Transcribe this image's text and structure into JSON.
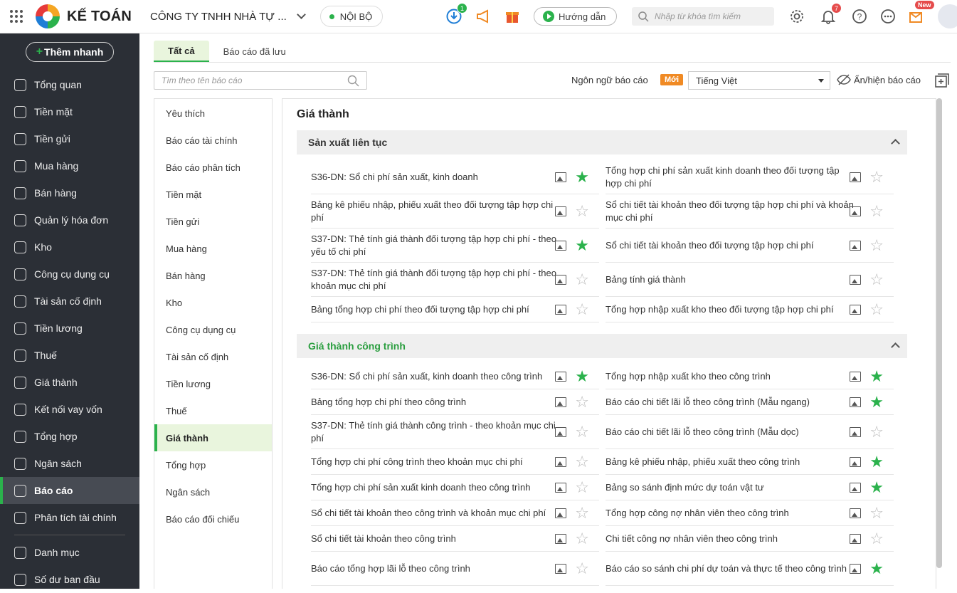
{
  "header": {
    "brand": "KẾ TOÁN",
    "company": "CÔNG TY TNHH NHÀ TỰ ...",
    "scope": "NỘI BỘ",
    "download_badge": "1",
    "guide_label": "Hướng dẫn",
    "search_placeholder": "Nhập từ khóa tìm kiếm",
    "notification_badge": "7",
    "new_badge": "New"
  },
  "sidebar": {
    "quick_add": "Thêm nhanh",
    "items": [
      {
        "label": "Tổng quan",
        "icon": "gauge-icon"
      },
      {
        "label": "Tiền mặt",
        "icon": "money-bag-icon"
      },
      {
        "label": "Tiền gửi",
        "icon": "bank-icon"
      },
      {
        "label": "Mua hàng",
        "icon": "shopping-bag-icon"
      },
      {
        "label": "Bán hàng",
        "icon": "cart-icon"
      },
      {
        "label": "Quản lý hóa đơn",
        "icon": "invoice-icon"
      },
      {
        "label": "Kho",
        "icon": "warehouse-icon"
      },
      {
        "label": "Công cụ dụng cụ",
        "icon": "tools-icon"
      },
      {
        "label": "Tài sản cố định",
        "icon": "car-icon"
      },
      {
        "label": "Tiền lương",
        "icon": "payroll-icon"
      },
      {
        "label": "Thuế",
        "icon": "tax-icon"
      },
      {
        "label": "Giá thành",
        "icon": "price-tag-icon"
      },
      {
        "label": "Kết nối vay vốn",
        "icon": "loan-icon"
      },
      {
        "label": "Tổng hợp",
        "icon": "summary-icon"
      },
      {
        "label": "Ngân sách",
        "icon": "budget-icon"
      },
      {
        "label": "Báo cáo",
        "icon": "report-icon",
        "active": true
      },
      {
        "label": "Phân tích tài chính",
        "icon": "analysis-icon"
      },
      {
        "label": "Danh mục",
        "icon": "list-icon"
      },
      {
        "label": "Số dư ban đầu",
        "icon": "balance-icon"
      }
    ]
  },
  "tabs": [
    "Tất cả",
    "Báo cáo đã lưu"
  ],
  "toolbar": {
    "search_placeholder": "Tìm theo tên báo cáo",
    "lang_label": "Ngôn ngữ báo cáo",
    "new_tag": "Mới",
    "lang_value": "Tiếng Việt",
    "toggle_label": "Ẩn/hiện báo cáo"
  },
  "categories": [
    "Yêu thích",
    "Báo cáo tài chính",
    "Báo cáo phân tích",
    "Tiền mặt",
    "Tiền gửi",
    "Mua hàng",
    "Bán hàng",
    "Kho",
    "Công cụ dụng cụ",
    "Tài sản cố định",
    "Tiền lương",
    "Thuế",
    "Giá thành",
    "Tổng hợp",
    "Ngân sách",
    "Báo cáo đối chiếu"
  ],
  "active_category": "Giá thành",
  "main": {
    "title": "Giá thành",
    "sections": [
      {
        "title": "Sản xuất liên tục",
        "highlight": false,
        "left": [
          {
            "name": "S36-DN: Sổ chi phí sản xuất, kinh doanh",
            "fav": true
          },
          {
            "name": "Bảng kê phiếu nhập, phiếu xuất theo đối tượng tập hợp chi phí",
            "fav": false
          },
          {
            "name": "S37-DN: Thẻ tính giá thành đối tượng tập hợp chi phí - theo yếu tố chi phí",
            "fav": true
          },
          {
            "name": "S37-DN: Thẻ tính giá thành đối tượng tập hợp chi phí - theo khoản mục chi phí",
            "fav": false
          },
          {
            "name": "Bảng tổng hợp chi phí theo đối tượng tập hợp chi phí",
            "fav": false
          }
        ],
        "right": [
          {
            "name": "Tổng hợp chi phí sản xuất kinh doanh theo đối tượng tập hợp chi phí",
            "fav": false
          },
          {
            "name": "Sổ chi tiết tài khoản theo đối tượng tập hợp chi phí và khoản mục chi phí",
            "fav": false
          },
          {
            "name": "Sổ chi tiết tài khoản theo đối tượng tập hợp chi phí",
            "fav": false
          },
          {
            "name": "Bảng tính giá thành",
            "fav": false
          },
          {
            "name": "Tổng hợp nhập xuất kho theo đối tượng tập hợp chi phí",
            "fav": false
          }
        ]
      },
      {
        "title": "Giá thành công trình",
        "highlight": true,
        "left": [
          {
            "name": "S36-DN: Sổ chi phí sản xuất, kinh doanh theo công trình",
            "fav": true
          },
          {
            "name": "Bảng tổng hợp chi phí theo công trình",
            "fav": false
          },
          {
            "name": "S37-DN: Thẻ tính giá thành công trình - theo khoản mục chi phí",
            "fav": false
          },
          {
            "name": "Tổng hợp chi phí công trình theo khoản mục chi phí",
            "fav": false
          },
          {
            "name": "Tổng hợp chi phí sản xuất kinh doanh theo công trình",
            "fav": false
          },
          {
            "name": "Sổ chi tiết tài khoản theo công trình và khoản mục chi phí",
            "fav": false
          },
          {
            "name": "Sổ chi tiết tài khoản theo công trình",
            "fav": false
          },
          {
            "name": "Báo cáo tổng hợp lãi lỗ theo công trình",
            "fav": false
          }
        ],
        "right": [
          {
            "name": "Tổng hợp nhập xuất kho theo công trình",
            "fav": true
          },
          {
            "name": "Báo cáo chi tiết lãi lỗ theo công trình (Mẫu ngang)",
            "fav": true
          },
          {
            "name": "Báo cáo chi tiết lãi lỗ theo công trình (Mẫu dọc)",
            "fav": false
          },
          {
            "name": "Bảng kê phiếu nhập, phiếu xuất theo công trình",
            "fav": true
          },
          {
            "name": "Bảng so sánh định mức dự toán vật tư",
            "fav": true
          },
          {
            "name": "Tổng hợp công nợ nhân viên theo công trình",
            "fav": false
          },
          {
            "name": "Chi tiết công nợ nhân viên theo công trình",
            "fav": false
          },
          {
            "name": "Báo cáo so sánh chi phí dự toán và thực tế theo công trình",
            "fav": true
          }
        ]
      }
    ]
  },
  "colors": {
    "accent": "#2bb24c",
    "sidebar": "#2b2f36",
    "new_tag": "#f08a24"
  }
}
